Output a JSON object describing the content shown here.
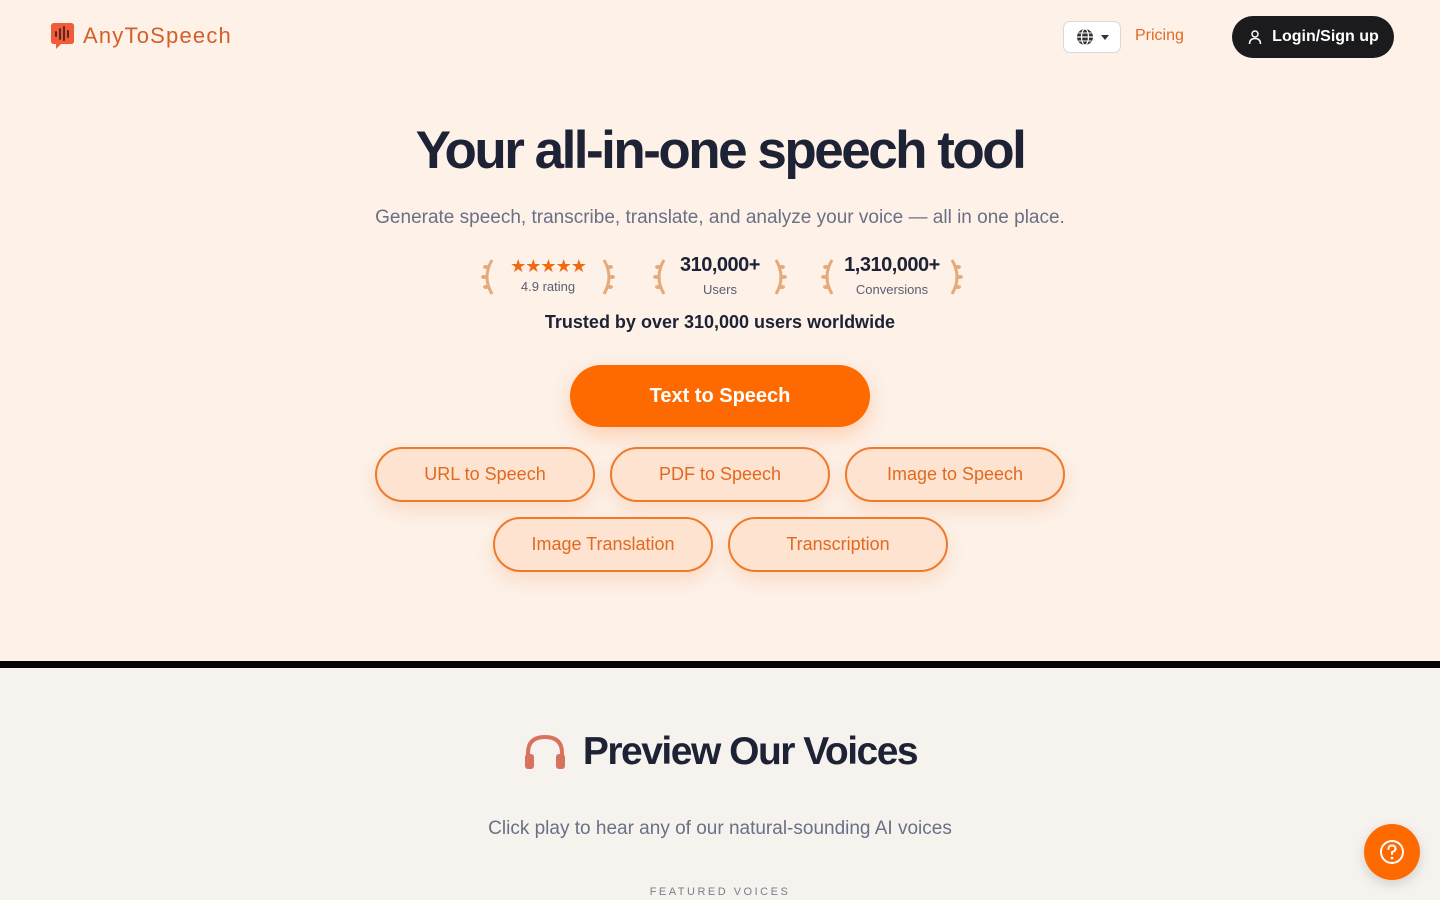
{
  "nav": {
    "logo_text": "AnyToSpeech",
    "pricing_label": "Pricing",
    "login_label": "Login/Sign up"
  },
  "hero": {
    "title": "Your all-in-one speech tool",
    "subtitle": "Generate speech, transcribe, translate, and analyze your voice — all in one place.",
    "stats": {
      "rating_stars": "★★★★★",
      "rating_label": "4.9 rating",
      "users_value": "310,000+",
      "users_label": "Users",
      "conversions_value": "1,310,000+",
      "conversions_label": "Conversions"
    },
    "trusted": "Trusted by over 310,000 users worldwide",
    "primary_button": "Text to Speech",
    "tools": [
      "URL to Speech",
      "PDF to Speech",
      "Image to Speech",
      "Image Translation",
      "Transcription"
    ]
  },
  "voices": {
    "title": "Preview Our Voices",
    "subtitle": "Click play to hear any of our natural-sounding AI voices",
    "featured_label": "FEATURED VOICES"
  },
  "colors": {
    "accent": "#ff6a00",
    "brand": "#d35f2a",
    "background": "#fdf1e8",
    "text": "#1e2235"
  },
  "icons": [
    "logo-icon",
    "globe-icon",
    "user-icon",
    "laurel-icon",
    "headphones-icon",
    "help-icon"
  ]
}
